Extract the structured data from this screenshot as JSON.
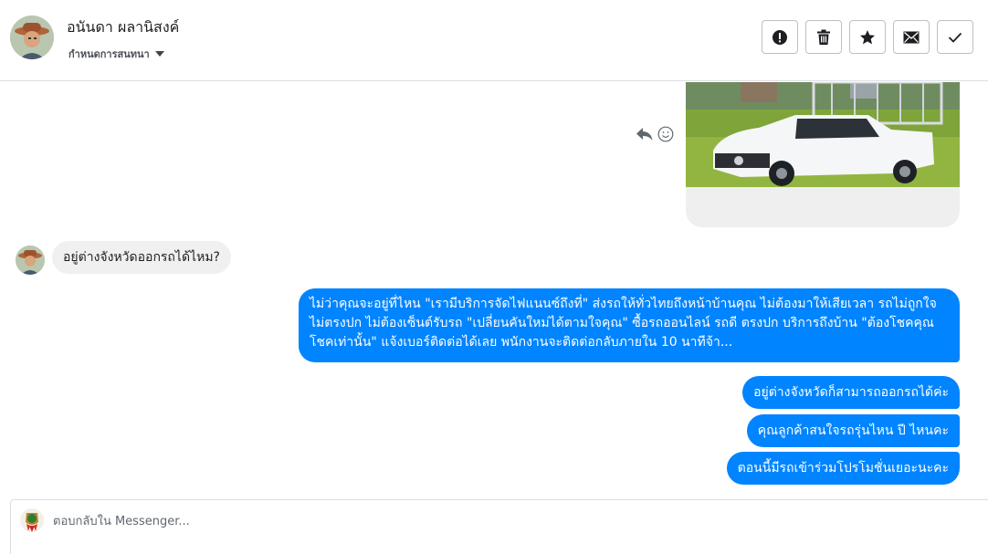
{
  "header": {
    "contact_name": "อนันดา ผลานิสงค์",
    "label_dropdown": "กำหนดการสนทนา",
    "actions": [
      {
        "name": "spam-icon"
      },
      {
        "name": "trash-icon"
      },
      {
        "name": "star-icon"
      },
      {
        "name": "envelope-icon"
      },
      {
        "name": "checkmark-icon"
      }
    ]
  },
  "messages": {
    "incoming_1": "อยู่ต่างจังหวัดออกรถได้ไหม?",
    "outgoing_long": "ไม่ว่าคุณจะอยู่ที่ไหน \"เรามีบริการจัดไฟแนนซ์ถึงที่\"  ส่งรถให้ทั่วไทยถึงหน้าบ้านคุณ ไม่ต้องมาให้เสียเวลา รถไม่ถูกใจ ไม่ตรงปก ไม่ต้องเซ็นต์รับรถ \"เปลี่ยนคันใหม่ได้ตามใจคุณ\" ซื้อรถออนไลน์ รถดี ตรงปก บริการถึงบ้าน \"ต้องโชคคุณโชคเท่านั้น\" แจ้งเบอร์ติดต่อได้เลย พนักงานจะติดต่อกลับภายใน 10 นาทีจ้า...",
    "outgoing_1": "อยู่ต่างจังหวัดก็สามารถออกรถได้ค่ะ",
    "outgoing_2": "คุณลูกค้าสนใจรถรุ่นไหน ปี ไหนคะ",
    "outgoing_3": "ตอนนี้มีรถเข้าร่วมโปรโมชั่นเยอะนะคะ"
  },
  "composer": {
    "placeholder": "ตอบกลับใน Messenger..."
  },
  "colors": {
    "outgoing_bubble": "#0084ff",
    "incoming_bubble": "#f0f0f0",
    "image_bubble_bg": "#efefef"
  }
}
